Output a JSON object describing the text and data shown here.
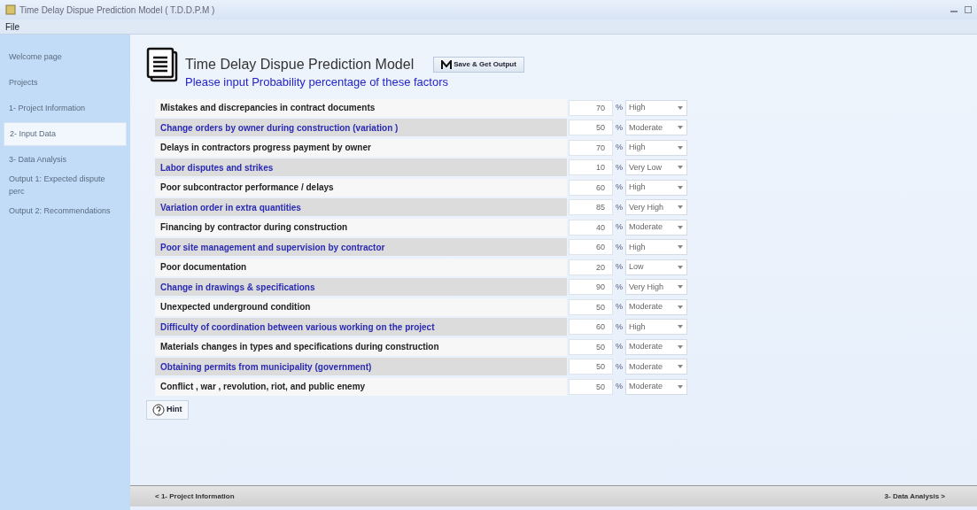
{
  "window": {
    "title": "Time Delay Dispue Prediction Model ( T.D.D.P.M )"
  },
  "menu": [
    "File"
  ],
  "sidebar": {
    "items": [
      {
        "label": "Welcome page",
        "selected": false
      },
      {
        "label": "Projects",
        "selected": false
      },
      {
        "label": "1- Project Information",
        "selected": false
      },
      {
        "label": "2- Input Data",
        "selected": true
      },
      {
        "label": "3- Data Analysis",
        "selected": false
      },
      {
        "label": "Output 1: Expected dispute perc",
        "selected": false
      },
      {
        "label": "Output 2: Recommendations",
        "selected": false
      }
    ]
  },
  "header": {
    "title": "Time Delay Dispue Prediction Model",
    "subtitle": "Please input Probability percentage of these factors",
    "save_button": "Save & Get Output"
  },
  "factors": [
    {
      "label": "Mistakes and discrepancies in contract documents",
      "highlighted": false,
      "value": "70",
      "unit": "%",
      "rating": "High"
    },
    {
      "label": "Change orders by owner during construction (variation )",
      "highlighted": true,
      "value": "50",
      "unit": "%",
      "rating": "Moderate"
    },
    {
      "label": "Delays in contractors progress payment by owner",
      "highlighted": false,
      "value": "70",
      "unit": "%",
      "rating": "High"
    },
    {
      "label": "Labor disputes and strikes",
      "highlighted": true,
      "value": "10",
      "unit": "%",
      "rating": "Very Low"
    },
    {
      "label": "Poor subcontractor performance / delays",
      "highlighted": false,
      "value": "60",
      "unit": "%",
      "rating": "High"
    },
    {
      "label": "Variation order in extra quantities",
      "highlighted": true,
      "value": "85",
      "unit": "%",
      "rating": "Very High"
    },
    {
      "label": "Financing by contractor during construction",
      "highlighted": false,
      "value": "40",
      "unit": "%",
      "rating": "Moderate"
    },
    {
      "label": "Poor site management and supervision by contractor",
      "highlighted": true,
      "value": "60",
      "unit": "%",
      "rating": "High"
    },
    {
      "label": "Poor documentation",
      "highlighted": false,
      "value": "20",
      "unit": "%",
      "rating": "Low"
    },
    {
      "label": "Change in drawings & specifications",
      "highlighted": true,
      "value": "90",
      "unit": "%",
      "rating": "Very High"
    },
    {
      "label": "Unexpected underground condition",
      "highlighted": false,
      "value": "50",
      "unit": "%",
      "rating": "Moderate"
    },
    {
      "label": "Difficulty of coordination between various working on the project",
      "highlighted": true,
      "value": "60",
      "unit": "%",
      "rating": "High"
    },
    {
      "label": "Materials changes in types and specifications during construction",
      "highlighted": false,
      "value": "50",
      "unit": "%",
      "rating": "Moderate"
    },
    {
      "label": "Obtaining permits from municipality (government)",
      "highlighted": true,
      "value": "50",
      "unit": "%",
      "rating": "Moderate"
    },
    {
      "label": "Conflict , war , revolution, riot, and public enemy",
      "highlighted": false,
      "value": "50",
      "unit": "%",
      "rating": "Moderate"
    }
  ],
  "hint_button": "Hint",
  "footer": {
    "back": "< 1- Project Information",
    "next": "3- Data Analysis >"
  }
}
